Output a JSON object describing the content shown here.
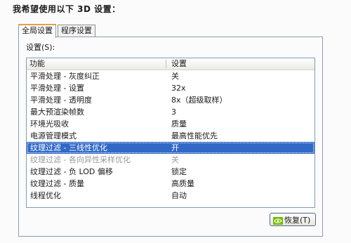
{
  "heading": "我希望使用以下 3D 设置：",
  "tabs": [
    {
      "label": "全局设置",
      "active": true
    },
    {
      "label": "程序设置",
      "active": false
    }
  ],
  "settings_label": "设置(S):",
  "columns": {
    "feature": "功能",
    "setting": "设置"
  },
  "rows": [
    {
      "feature": "平滑处理 - 灰度纠正",
      "value": "关"
    },
    {
      "feature": "平滑处理 - 设置",
      "value": "32x"
    },
    {
      "feature": "平滑处理 - 透明度",
      "value": "8x（超级取样）"
    },
    {
      "feature": "最大预渲染帧数",
      "value": "3"
    },
    {
      "feature": "环境光吸收",
      "value": "质量"
    },
    {
      "feature": "电源管理模式",
      "value": "最高性能优先"
    },
    {
      "feature": "纹理过滤 - 三线性优化",
      "value": "开"
    },
    {
      "feature": "纹理过滤 - 各向异性采样优化",
      "value": "关"
    },
    {
      "feature": "纹理过滤 - 负 LOD 偏移",
      "value": "锁定"
    },
    {
      "feature": "纹理过滤 - 质量",
      "value": "高质量"
    },
    {
      "feature": "线程优化",
      "value": "自动"
    }
  ],
  "selected_row": 6,
  "disabled_rows": [
    7
  ],
  "restore_button": "恢复(T)",
  "icons": {
    "restore": "nvidia-logo-icon"
  },
  "colors": {
    "selection": "#3169c6",
    "tab_accent": "#e2a23a",
    "nvidia_green": "#76b900"
  }
}
